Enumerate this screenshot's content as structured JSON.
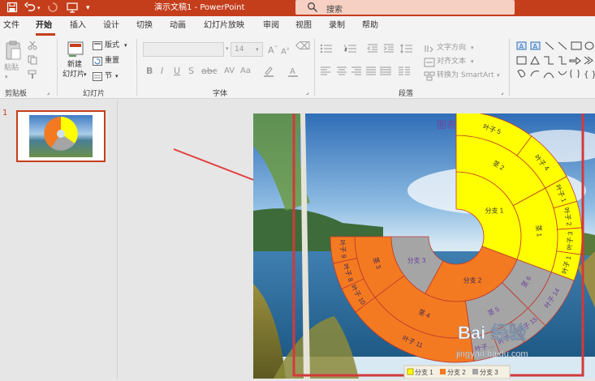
{
  "titlebar": {
    "doc_title": "演示文稿1 - PowerPoint",
    "search_placeholder": "搜索"
  },
  "tabs": [
    "文件",
    "开始",
    "插入",
    "设计",
    "切换",
    "动画",
    "幻灯片放映",
    "审阅",
    "视图",
    "录制",
    "帮助"
  ],
  "active_tab": "开始",
  "ribbon": {
    "clipboard": {
      "paste": "粘贴",
      "group": "剪贴板"
    },
    "slides": {
      "new_slide_1": "新建",
      "new_slide_2": "幻灯片",
      "layout": "版式",
      "reset": "重置",
      "section": "节",
      "group": "幻灯片"
    },
    "font": {
      "size": "14",
      "group": "字体"
    },
    "paragraph": {
      "text_direction": "文字方向",
      "align_text": "对齐文本",
      "smartart": "转换为 SmartArt",
      "group": "段落"
    }
  },
  "slide_panel": {
    "number": "1"
  },
  "chart_data": {
    "type": "sunburst",
    "title": "图表标题",
    "rings": {
      "inner": [
        {
          "label": "分支 1",
          "value": 9,
          "color": "#ffff00"
        },
        {
          "label": "分支 2",
          "value": 8,
          "color": "#f47a22"
        },
        {
          "label": "分支 3",
          "value": 5,
          "color": "#a5a5a5"
        }
      ],
      "middle": [
        {
          "label": "茎 2",
          "parent": "分支 1",
          "value": 5
        },
        {
          "label": "茎 1",
          "parent": "分支 1",
          "value": 4
        },
        {
          "label": "茎 6",
          "parent": "分支 3",
          "value": 2
        },
        {
          "label": "茎 5",
          "parent": "分支 3",
          "value": 3
        },
        {
          "label": "茎 4",
          "parent": "分支 2",
          "value": 5
        },
        {
          "label": "茎 3",
          "parent": "分支 2",
          "value": 3
        }
      ],
      "outer": [
        {
          "label": "叶子 5",
          "parent": "茎 2",
          "value": 3
        },
        {
          "label": "叶子 4",
          "parent": "茎 2",
          "value": 2
        },
        {
          "label": "叶子 1",
          "parent": "茎 1",
          "value": 1
        },
        {
          "label": "叶子 2",
          "parent": "茎 1",
          "value": 1
        },
        {
          "label": "叶子 3",
          "parent": "茎 1",
          "value": 1
        },
        {
          "label": "叶子 1",
          "parent": "茎 1",
          "value": 1
        },
        {
          "label": "叶子 14",
          "parent": "茎 6",
          "value": 2
        },
        {
          "label": "叶子 15",
          "parent": "茎 5",
          "value": 1
        },
        {
          "label": "叶子…",
          "parent": "茎 5",
          "value": 1
        },
        {
          "label": "叶子…",
          "parent": "茎 5",
          "value": 1
        },
        {
          "label": "叶子 11",
          "parent": "茎 4",
          "value": 5
        },
        {
          "label": "叶子 10",
          "parent": "茎 3",
          "value": 1
        },
        {
          "label": "叶子 8",
          "parent": "茎 3",
          "value": 1
        },
        {
          "label": "叶子 9",
          "parent": "茎 3",
          "value": 1
        }
      ]
    },
    "legend": [
      "分支 1",
      "分支 2",
      "分支 3"
    ],
    "legend_placement": "bottom"
  },
  "watermark": {
    "brand": "Bai 经验",
    "url": "jingyan.baidu.com"
  }
}
